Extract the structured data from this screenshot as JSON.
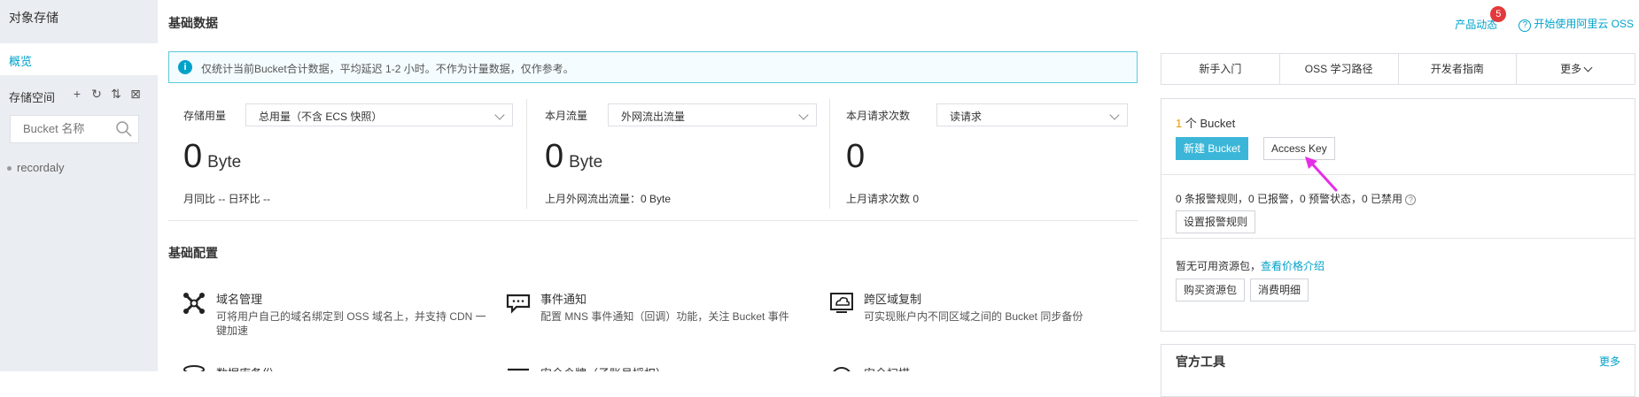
{
  "sidebar": {
    "title": "对象存储",
    "active_item": "概览",
    "bucket_heading": "存储空间",
    "tool_icons": [
      "+",
      "↻",
      "⇅",
      "⊠"
    ],
    "search_placeholder": "Bucket 名称",
    "buckets": [
      "recordaly"
    ]
  },
  "header": {
    "title": "基础数据",
    "product_news": "产品动态",
    "badge_count": "5",
    "start_link": "开始使用阿里云 OSS"
  },
  "notice": {
    "text": "仅统计当前Bucket合计数据，平均延迟 1-2 小时。不作为计量数据，仅作参考。"
  },
  "stats": [
    {
      "label": "存储用量",
      "select": "总用量（不含 ECS 快照）",
      "value": "0",
      "unit": "Byte",
      "sub": "月同比 -- 日环比 --"
    },
    {
      "label": "本月流量",
      "select": "外网流出流量",
      "value": "0",
      "unit": "Byte",
      "sub": "上月外网流出流量：0 Byte"
    },
    {
      "label": "本月请求次数",
      "select": "读请求",
      "value": "0",
      "unit": "",
      "sub": "上月请求次数 0"
    }
  ],
  "config": {
    "title": "基础配置",
    "items": [
      {
        "name": "域名管理",
        "desc": "可将用户自己的域名绑定到 OSS 域名上，并支持 CDN 一键加速"
      },
      {
        "name": "事件通知",
        "desc": "配置 MNS 事件通知（回调）功能，关注 Bucket 事件"
      },
      {
        "name": "跨区域复制",
        "desc": "可实现账户内不同区域之间的 Bucket 同步备份"
      },
      {
        "name": "数据库备份",
        "desc": ""
      },
      {
        "name": "安全令牌（子账号授权）",
        "desc": ""
      },
      {
        "name": "安全扫描",
        "desc": ""
      }
    ]
  },
  "right": {
    "tabs": [
      "新手入门",
      "OSS 学习路径",
      "开发者指南",
      "更多"
    ],
    "bucket_count": "1",
    "bucket_count_label": "个 Bucket",
    "new_bucket": "新建 Bucket",
    "access_key": "Access Key",
    "alert_text": "0 条报警规则，0 已报警，0 预警状态，0 已禁用",
    "alert_button": "设置报警规则",
    "resource_text": "暂无可用资源包，",
    "resource_link": "查看价格介绍",
    "buy_button": "购买资源包",
    "detail_button": "消费明细",
    "tools_title": "官方工具",
    "tools_more": "更多"
  },
  "colors": {
    "accent": "#00a2ca",
    "primary_button": "#3bb6d8",
    "badge": "#e4393c",
    "annotation_arrow": "#e62ee6"
  }
}
